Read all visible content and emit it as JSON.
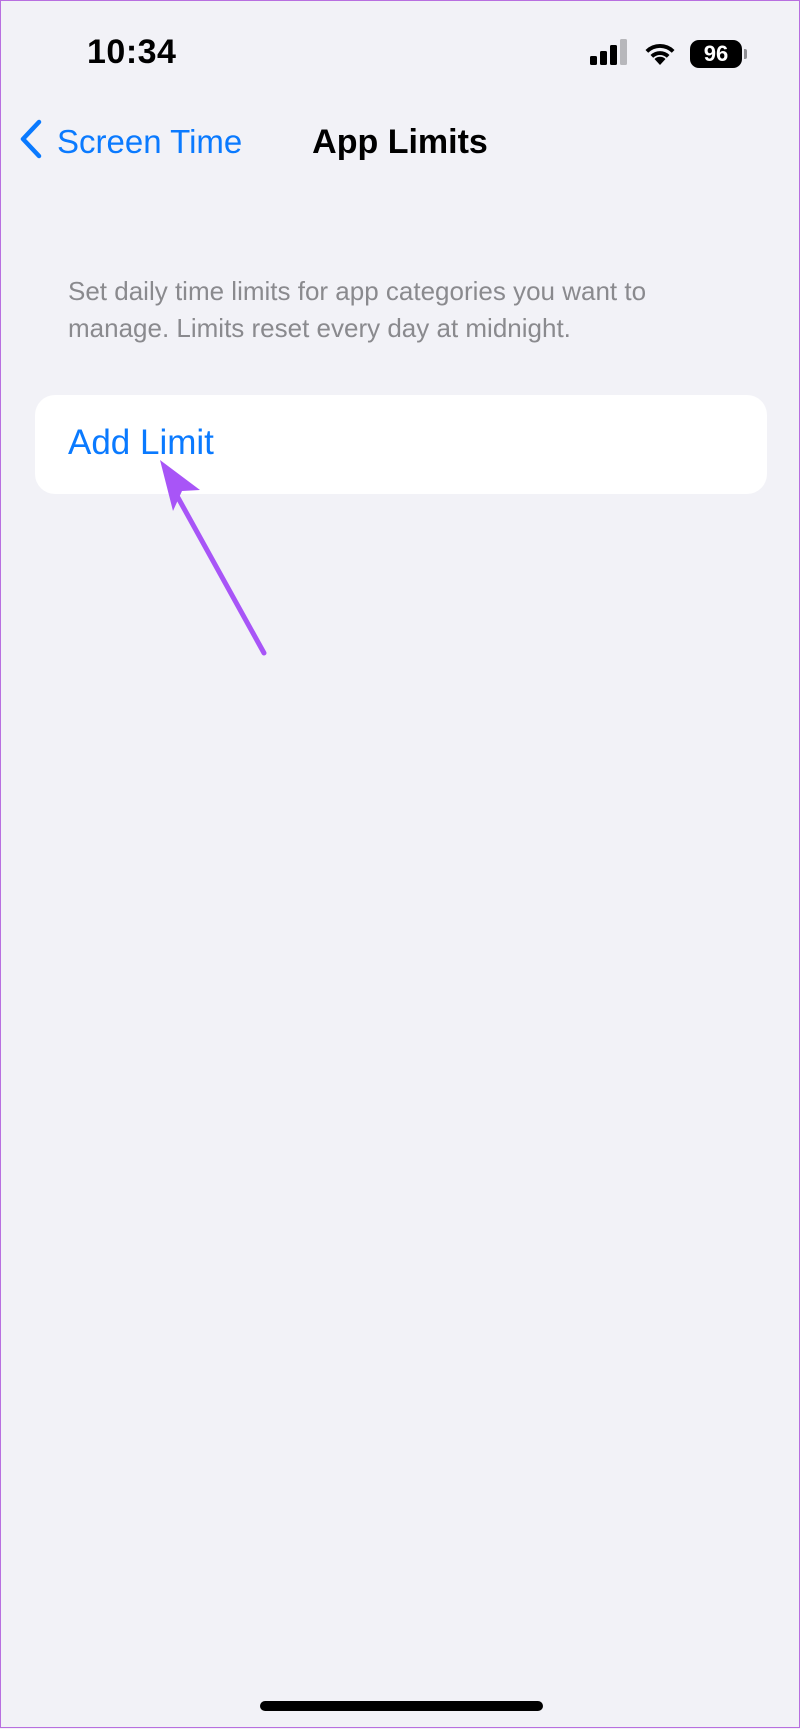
{
  "status_bar": {
    "time": "10:34",
    "battery_level": "96",
    "icons": [
      "signal-icon",
      "wifi-icon",
      "battery-icon"
    ]
  },
  "nav": {
    "back_label": "Screen Time",
    "title": "App Limits"
  },
  "main": {
    "description": "Set daily time limits for app categories you want to manage. Limits reset every day at midnight.",
    "add_limit_label": "Add Limit"
  },
  "colors": {
    "accent": "#0a7aff",
    "background": "#f2f2f7",
    "annotation_arrow": "#a855f7"
  }
}
